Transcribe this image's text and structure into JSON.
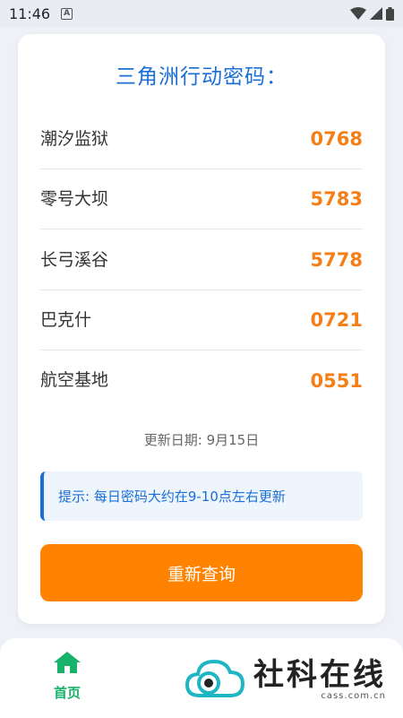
{
  "status_bar": {
    "time": "11:46",
    "notification_icon": "A"
  },
  "card": {
    "title": "三角洲行动密码：",
    "rows": [
      {
        "name": "潮汐监狱",
        "code": "0768"
      },
      {
        "name": "零号大坝",
        "code": "5783"
      },
      {
        "name": "长弓溪谷",
        "code": "5778"
      },
      {
        "name": "巴克什",
        "code": "0721"
      },
      {
        "name": "航空基地",
        "code": "0551"
      }
    ],
    "update_date": "更新日期: 9月15日",
    "tip": "提示: 每日密码大约在9-10点左右更新",
    "refresh_button": "重新查询"
  },
  "tabbar": {
    "home_label": "首页"
  },
  "watermark": {
    "text": "社科在线",
    "domain": "cass.com.cn"
  },
  "colors": {
    "accent_blue": "#1a6fd6",
    "code_orange": "#f57f17",
    "button_orange": "#ff8200",
    "home_green": "#19b26b"
  }
}
